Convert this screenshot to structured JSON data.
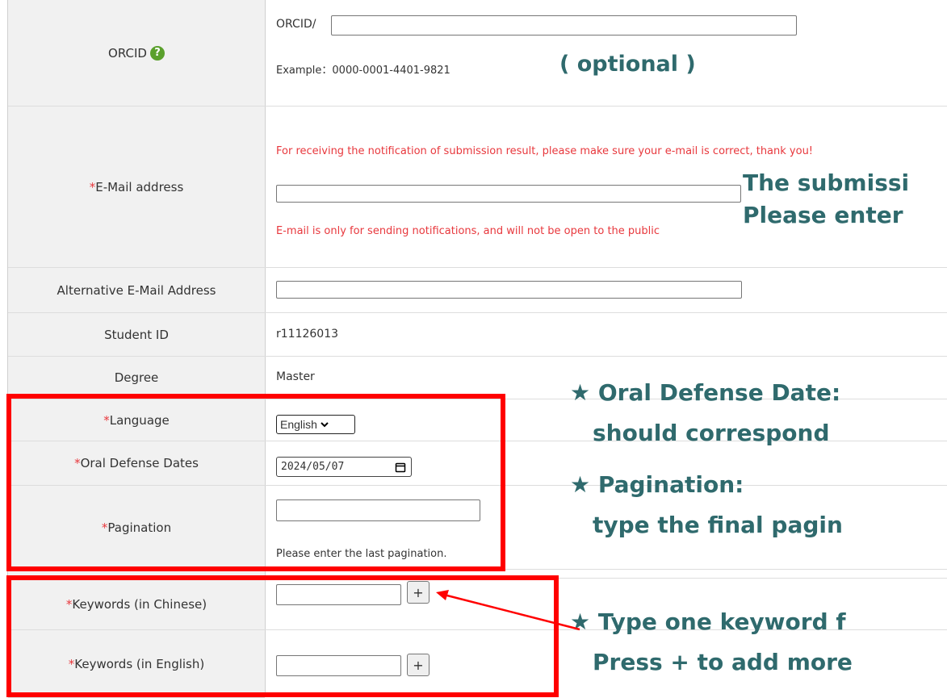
{
  "form": {
    "orcid": {
      "label": "ORCID",
      "prefix": "ORCID/",
      "example": "Example：0000-0001-4401-9821",
      "note": "( optional )"
    },
    "email": {
      "label": "E-Mail address",
      "notice": "For receiving the notification of submission result, please make sure your e-mail is correct, thank you!",
      "privacy": "E-mail is only for sending notifications, and will not be open to the public"
    },
    "alt_email": {
      "label": "Alternative E-Mail Address"
    },
    "student_id": {
      "label": "Student ID",
      "value": "r11126013"
    },
    "degree": {
      "label": "Degree",
      "value": "Master"
    },
    "language": {
      "label": "Language",
      "value": "English"
    },
    "oral_defense": {
      "label": "Oral Defense Dates",
      "value": "2024/05/07"
    },
    "pagination": {
      "label": "Pagination",
      "hint": "Please enter the last pagination."
    },
    "keywords_cn": {
      "label": "Keywords (in Chinese)",
      "add": "+"
    },
    "keywords_en": {
      "label": "Keywords (in English)",
      "add": "+"
    },
    "required_mark": "*"
  },
  "annotations": {
    "email_note_1": "The submissi",
    "email_note_2": "Please enter",
    "defense_1": "★ Oral Defense Date:",
    "defense_2": "should correspond",
    "pagination_1": "★ Pagination:",
    "pagination_2": "type the final pagin",
    "keyword_1": "★ Type one keyword f",
    "keyword_2": "Press + to add more"
  },
  "colors": {
    "required": "#e8383d",
    "annotation": "#2f6a6d",
    "highlight": "#ff0000",
    "help_icon": "#5aa02c"
  },
  "icons": [
    "help-icon",
    "calendar-icon",
    "chevron-down-icon",
    "arrow"
  ]
}
